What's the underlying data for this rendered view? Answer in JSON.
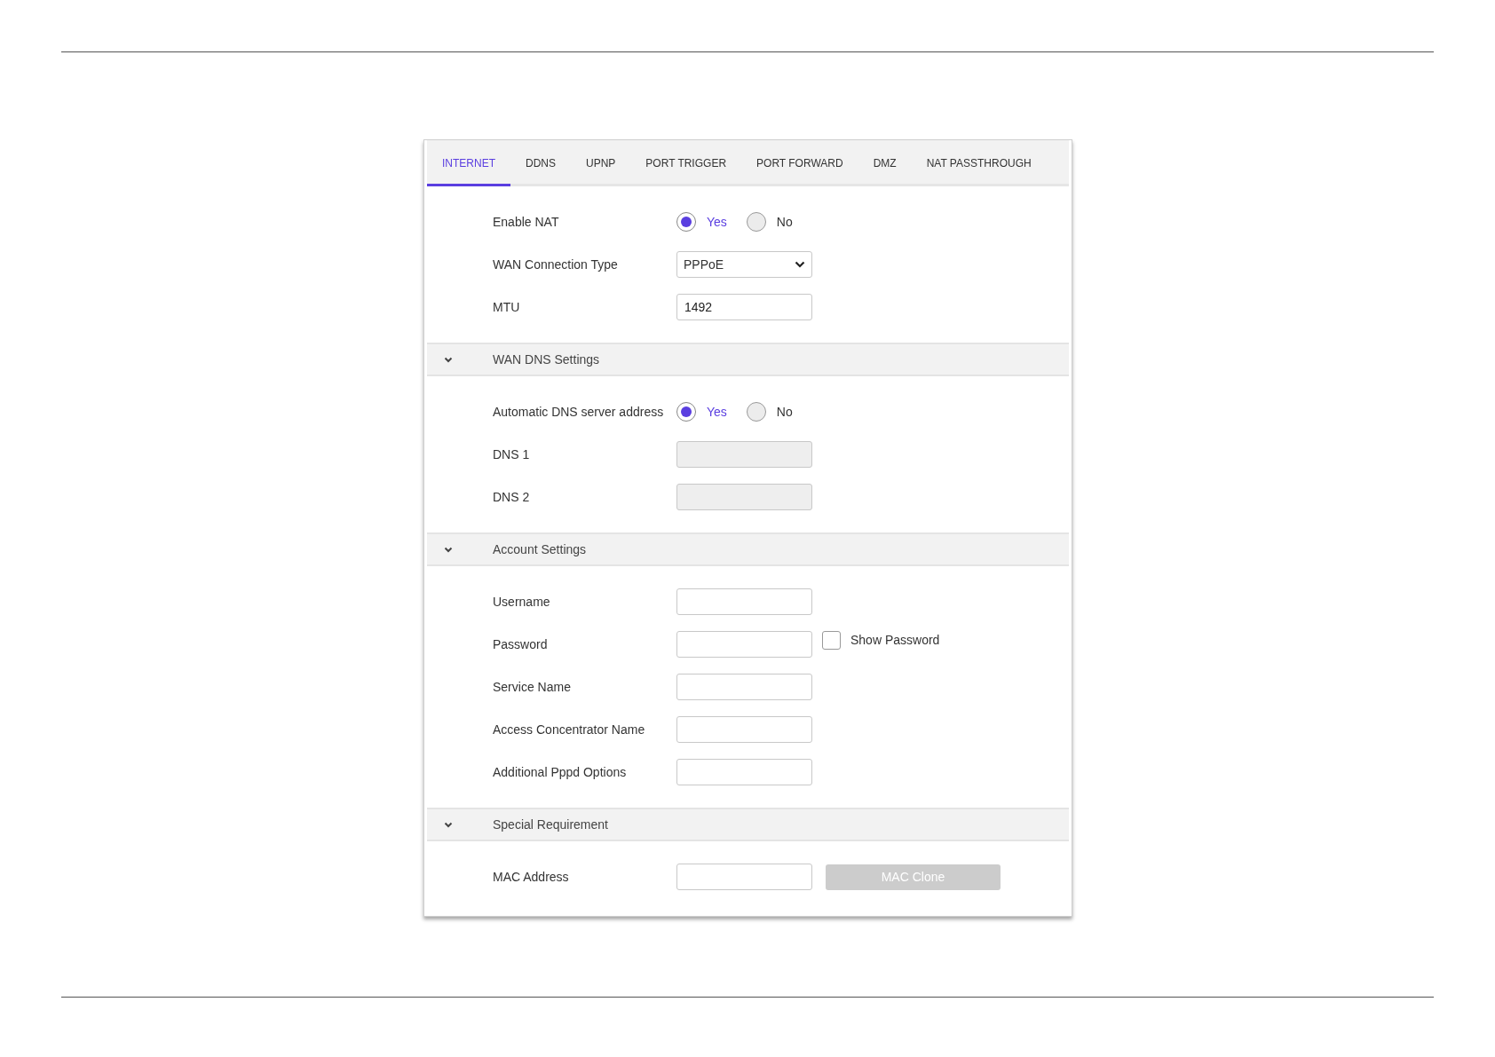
{
  "tabs": [
    {
      "label": "INTERNET",
      "selected": true
    },
    {
      "label": "DDNS",
      "selected": false
    },
    {
      "label": "UPNP",
      "selected": false
    },
    {
      "label": "PORT TRIGGER",
      "selected": false
    },
    {
      "label": "PORT FORWARD",
      "selected": false
    },
    {
      "label": "DMZ",
      "selected": false
    },
    {
      "label": "NAT PASSTHROUGH",
      "selected": false
    }
  ],
  "sections": [
    {
      "rows": [
        {
          "kind": "radio",
          "label": "Enable NAT",
          "options": [
            {
              "label": "Yes",
              "selected": true
            },
            {
              "label": "No",
              "selected": false
            }
          ]
        },
        {
          "kind": "select",
          "label": "WAN Connection Type",
          "value": "PPPoE"
        },
        {
          "kind": "input",
          "label": "MTU",
          "value": "1492",
          "disabled": false
        }
      ]
    },
    {
      "title": "WAN DNS Settings",
      "expanded": true,
      "rows": [
        {
          "kind": "radio",
          "label": "Automatic DNS server address",
          "options": [
            {
              "label": "Yes",
              "selected": true
            },
            {
              "label": "No",
              "selected": false
            }
          ]
        },
        {
          "kind": "input",
          "label": "DNS 1",
          "disabled": true
        },
        {
          "kind": "input",
          "label": "DNS 2",
          "disabled": true
        }
      ]
    },
    {
      "title": "Account Settings",
      "expanded": true,
      "rows": [
        {
          "kind": "input",
          "label": "Username",
          "disabled": false
        },
        {
          "kind": "input",
          "label": "Password",
          "disabled": false,
          "checkbox": {
            "label": "Show Password",
            "checked": false
          }
        },
        {
          "kind": "input",
          "label": "Service Name",
          "disabled": false
        },
        {
          "kind": "input",
          "label": "Access Concentrator Name",
          "disabled": false
        },
        {
          "kind": "input",
          "label": "Additional Pppd Options",
          "disabled": false
        }
      ]
    },
    {
      "title": "Special Requirement",
      "expanded": true,
      "rows": [
        {
          "kind": "input",
          "label": "MAC Address",
          "disabled": false,
          "button": {
            "label": "MAC Clone",
            "disabled": true
          }
        }
      ]
    }
  ]
}
